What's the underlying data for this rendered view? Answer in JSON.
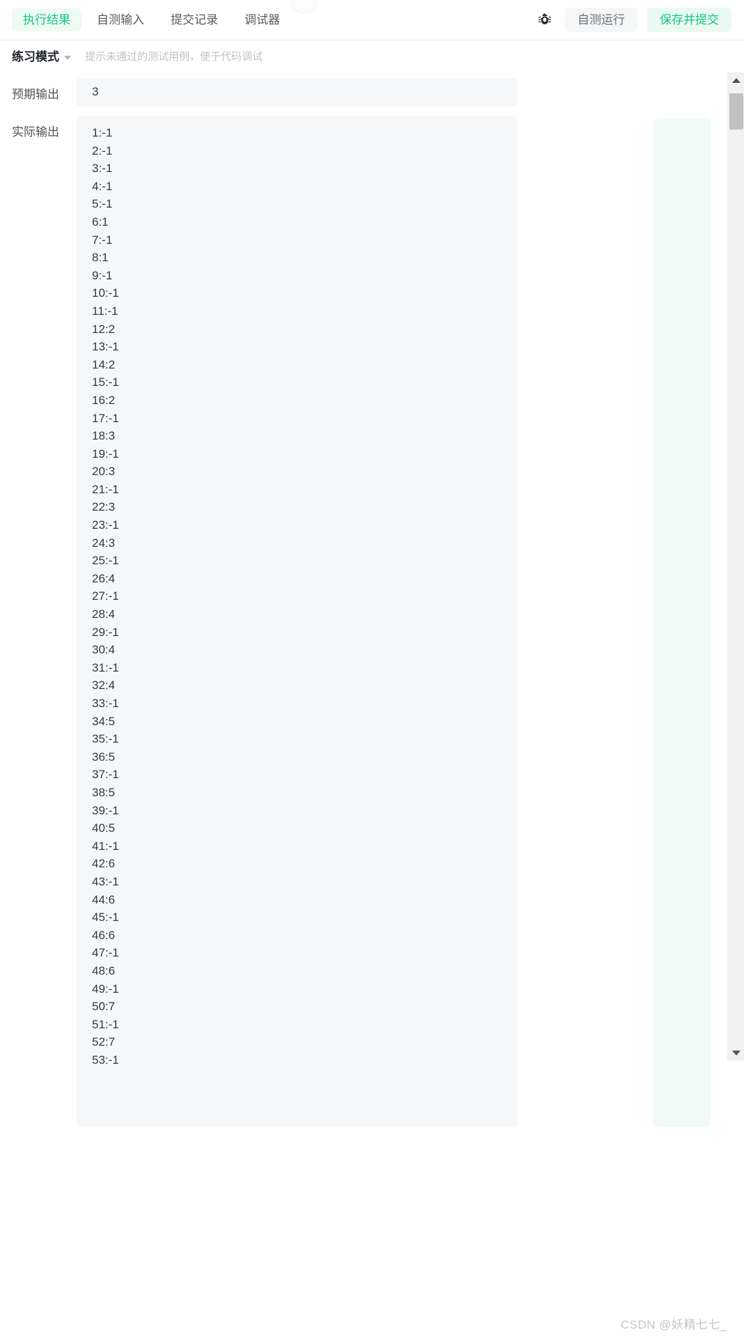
{
  "toolbar": {
    "tabs": [
      {
        "label": "执行结果",
        "active": true
      },
      {
        "label": "自测输入",
        "active": false
      },
      {
        "label": "提交记录",
        "active": false
      },
      {
        "label": "调试器",
        "active": false
      }
    ],
    "debug_icon": "bug-icon",
    "run_label": "自测运行",
    "submit_label": "保存并提交",
    "accent_color": "#16c784",
    "accent_bg": "#eafaf3",
    "secondary_bg": "#f5f6f7"
  },
  "mode_bar": {
    "mode_label": "练习模式",
    "dropdown_icon": "chevron-down-icon",
    "hint": "提示未通过的测试用例，便于代码调试"
  },
  "result": {
    "expected_label": "预期输出",
    "expected_value": "3",
    "actual_label": "实际输出",
    "actual_lines": [
      "1:-1",
      "2:-1",
      "3:-1",
      "4:-1",
      "5:-1",
      "6:1",
      "7:-1",
      "8:1",
      "9:-1",
      "10:-1",
      "11:-1",
      "12:2",
      "13:-1",
      "14:2",
      "15:-1",
      "16:2",
      "17:-1",
      "18:3",
      "19:-1",
      "20:3",
      "21:-1",
      "22:3",
      "23:-1",
      "24:3",
      "25:-1",
      "26:4",
      "27:-1",
      "28:4",
      "29:-1",
      "30:4",
      "31:-1",
      "32:4",
      "33:-1",
      "34:5",
      "35:-1",
      "36:5",
      "37:-1",
      "38:5",
      "39:-1",
      "40:5",
      "41:-1",
      "42:6",
      "43:-1",
      "44:6",
      "45:-1",
      "46:6",
      "47:-1",
      "48:6",
      "49:-1",
      "50:7",
      "51:-1",
      "52:7",
      "53:-1"
    ]
  },
  "scrollbar": {
    "up_icon": "triangle-up-icon",
    "down_icon": "triangle-down-icon",
    "thumb": "scrollbar-thumb"
  },
  "watermark": {
    "text": "CSDN @妖精七七_"
  }
}
